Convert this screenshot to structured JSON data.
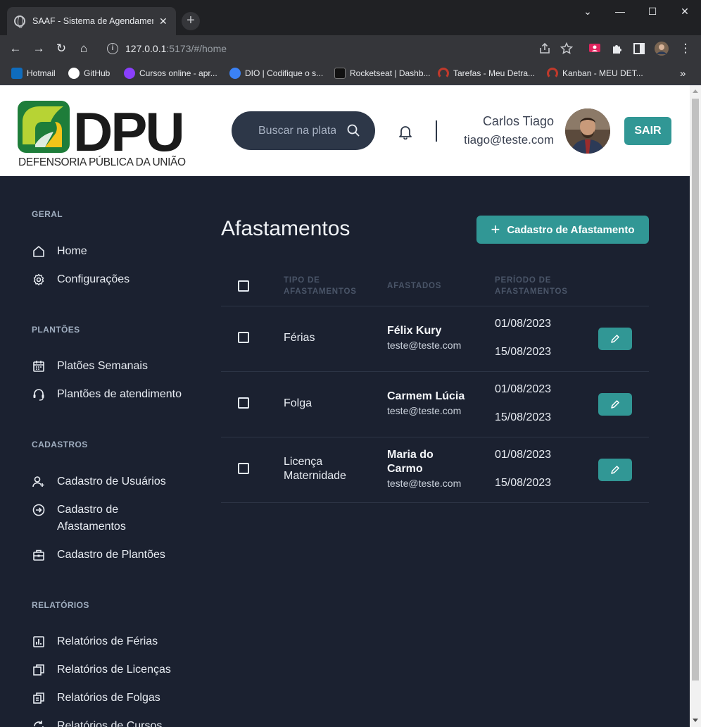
{
  "browser": {
    "tab_title": "SAAF - Sistema de Agendamento",
    "tab_close": "✕",
    "new_tab": "+",
    "url_host": "127.0.0.1",
    "url_rest": ":5173/#/home",
    "window_controls": {
      "minimize": "—",
      "maximize": "☐",
      "close": "✕",
      "chevron": "⌄"
    },
    "nav": {
      "back": "←",
      "forward": "→",
      "reload": "↻",
      "home": "⌂"
    },
    "info_icon": "i",
    "bookmarks_more": "»",
    "bookmarks": [
      {
        "label": "Hotmail",
        "color": "#0f6cbd"
      },
      {
        "label": "GitHub",
        "color": "#ffffff"
      },
      {
        "label": "Cursos online - apr...",
        "color": "#8a3ffc"
      },
      {
        "label": "DIO | Codifique o s...",
        "color": "#3b82f6"
      },
      {
        "label": "Rocketseat | Dashb...",
        "color": "#111111"
      },
      {
        "label": "Tarefas - Meu Detra...",
        "color": "#c0392b"
      },
      {
        "label": "Kanban - MEU DET...",
        "color": "#c0392b"
      }
    ]
  },
  "header": {
    "logo_text": "DPU",
    "logo_subtitle": "DEFENSORIA PÚBLICA DA UNIÃO",
    "search_placeholder": "Buscar na plataforma",
    "user_name": "Carlos Tiago",
    "user_email": "tiago@teste.com",
    "logout_label": "SAIR"
  },
  "sidebar": {
    "sections": [
      {
        "title": "GERAL",
        "items": [
          {
            "label": "Home",
            "icon": "home-icon"
          },
          {
            "label": "Configurações",
            "icon": "gear-icon"
          }
        ]
      },
      {
        "title": "PLANTÕES",
        "items": [
          {
            "label": "Platões Semanais",
            "icon": "calendar-icon"
          },
          {
            "label": "Plantões de atendimento",
            "icon": "headset-icon"
          }
        ]
      },
      {
        "title": "CADASTROS",
        "items": [
          {
            "label": "Cadastro de Usuários",
            "icon": "user-plus-icon"
          },
          {
            "label": "Cadastro de Afastamentos",
            "icon": "arrow-circle-icon"
          },
          {
            "label": "Cadastro de Plantões",
            "icon": "briefcase-icon"
          }
        ]
      },
      {
        "title": "RELATÓRIOS",
        "items": [
          {
            "label": "Relatórios de Férias",
            "icon": "report-chart-icon"
          },
          {
            "label": "Relatórios de Licenças",
            "icon": "copy-icon"
          },
          {
            "label": "Relatórios de Folgas",
            "icon": "documents-icon"
          },
          {
            "label": "Relatórios de Cursos",
            "icon": "refresh-doc-icon"
          }
        ]
      }
    ]
  },
  "main": {
    "title": "Afastamentos",
    "add_button_icon": "+",
    "add_button": "Cadastro de Afastamento",
    "columns": {
      "tipo": "Tipo de Afastamentos",
      "afastados": "Afastados",
      "periodo": "Período de Afastamentos"
    },
    "rows": [
      {
        "tipo": "Férias",
        "nome": "Félix Kury",
        "email": "teste@teste.com",
        "inicio": "01/08/2023",
        "fim": "15/08/2023"
      },
      {
        "tipo": "Folga",
        "nome": "Carmem Lúcia",
        "email": "teste@teste.com",
        "inicio": "01/08/2023",
        "fim": "15/08/2023"
      },
      {
        "tipo": "Licença Maternidade",
        "nome": "Maria do Carmo",
        "email": "teste@teste.com",
        "inicio": "01/08/2023",
        "fim": "15/08/2023"
      }
    ]
  },
  "colors": {
    "accent": "#319795",
    "sidebar_bg": "#1b2130",
    "search_bg": "#2d3748"
  }
}
